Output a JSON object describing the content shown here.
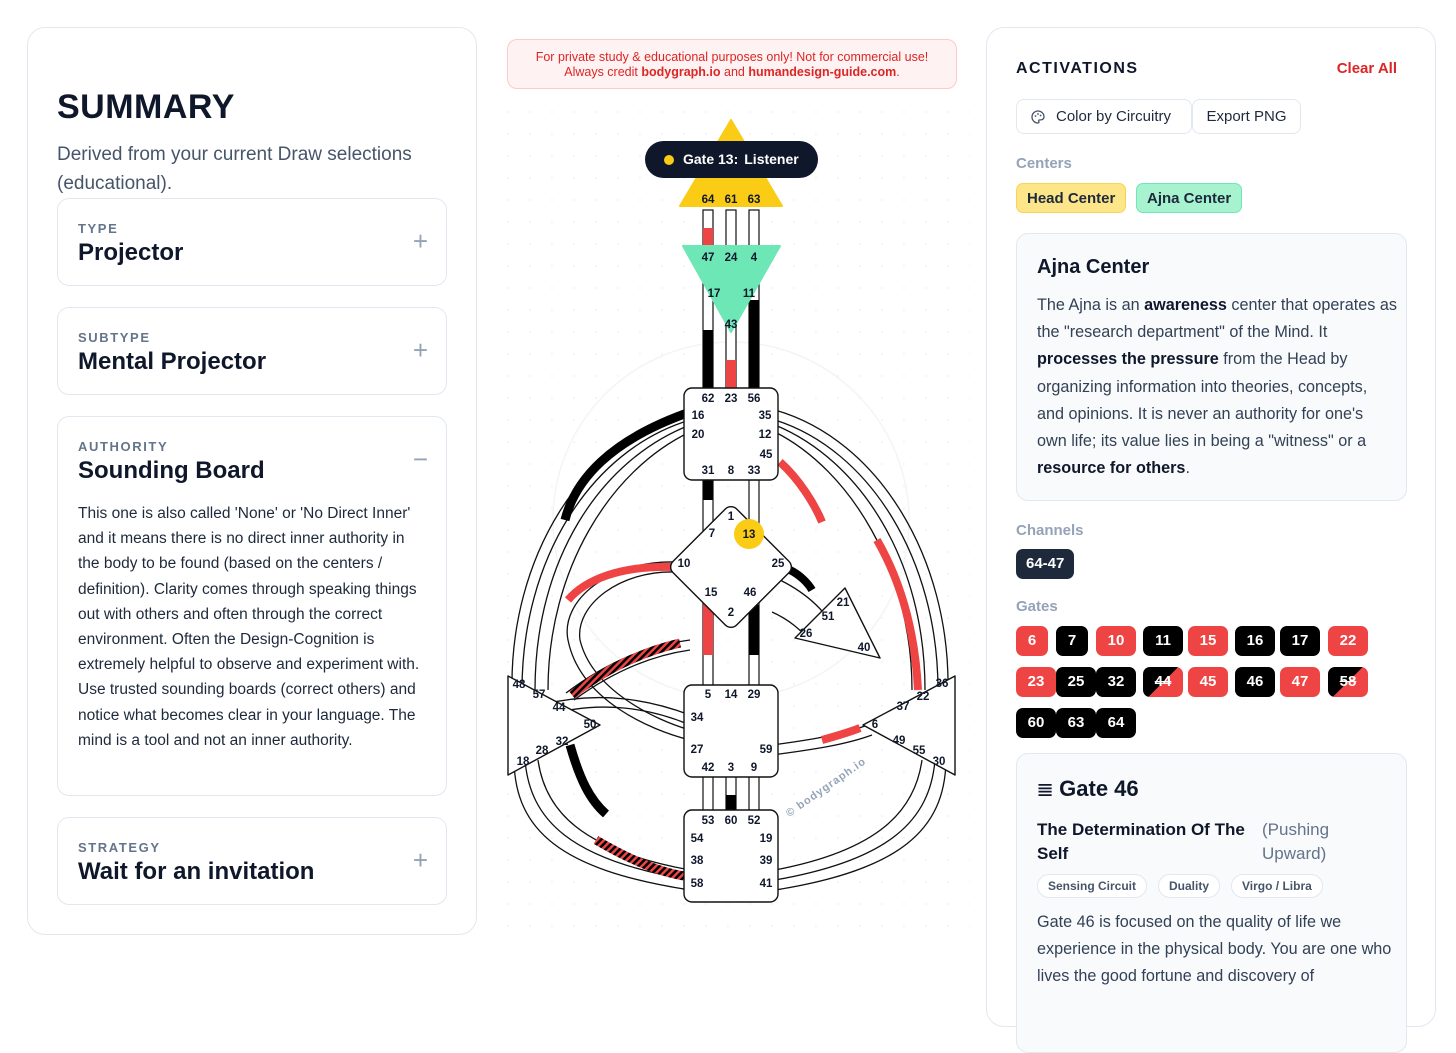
{
  "summary": {
    "title": "SUMMARY",
    "subtitle": "Derived from your current Draw selections (educational).",
    "type": {
      "label": "TYPE",
      "value": "Projector",
      "toggle": "+"
    },
    "subtype": {
      "label": "SUBTYPE",
      "value": "Mental Projector",
      "toggle": "+"
    },
    "authority": {
      "label": "AUTHORITY",
      "value": "Sounding Board",
      "toggle": "−",
      "body": "This one is also called 'None' or 'No Direct Inner' and it means there is no direct inner authority in the body to be found (based on the centers / definition). Clarity comes through speaking things out with others and often through the correct environment. Often the Design-Cognition is extremely helpful to observe and experiment with. Use trusted sounding boards (correct others) and notice what becomes clear in your language. The mind is a tool and not an inner authority."
    },
    "strategy": {
      "label": "STRATEGY",
      "value": "Wait for an invitation",
      "toggle": "+"
    }
  },
  "notice": {
    "line1": "For private study & educational purposes only! Not for commercial use!",
    "line2_prefix": "Always credit ",
    "link1": "bodygraph.io",
    "line2_mid": " and ",
    "link2": "humandesign-guide.com",
    "line2_suffix": "."
  },
  "tooltip": {
    "gate": "Gate 13:",
    "name": "Listener"
  },
  "watermark": "© bodygraph.io",
  "bodygraph": {
    "head_gates": [
      "64",
      "61",
      "63"
    ],
    "ajna_gates": [
      "47",
      "24",
      "4",
      "17",
      "11",
      "43"
    ],
    "throat_gates": [
      "62",
      "23",
      "56",
      "16",
      "35",
      "20",
      "12",
      "45",
      "31",
      "8",
      "33"
    ],
    "g_gates": [
      "1",
      "7",
      "13",
      "10",
      "25",
      "15",
      "46",
      "2"
    ],
    "ego_gates": [
      "21",
      "51",
      "26",
      "40"
    ],
    "spleen_gates": [
      "48",
      "57",
      "44",
      "50",
      "32",
      "28",
      "18"
    ],
    "sacral_gates": [
      "5",
      "14",
      "29",
      "34",
      "27",
      "59",
      "42",
      "3",
      "9"
    ],
    "solar_gates": [
      "36",
      "22",
      "37",
      "6",
      "49",
      "55",
      "30"
    ],
    "root_gates": [
      "53",
      "60",
      "52",
      "54",
      "19",
      "38",
      "39",
      "58",
      "41"
    ]
  },
  "activations": {
    "title": "ACTIVATIONS",
    "clear": "Clear All",
    "color_btn": "Color by Circuitry",
    "export_btn": "Export PNG",
    "centers_label": "Centers",
    "centers": [
      "Head Center",
      "Ajna Center"
    ],
    "info": {
      "title": "Ajna Center",
      "p1": "The Ajna is an ",
      "b1": "awareness",
      "p2": " center that operates as the \"research department\" of the Mind. It ",
      "b2": "processes the pressure",
      "p3": " from the Head by organizing information into theories, concepts, and opinions. It is never an authority for one's own life; its value lies in being a \"witness\" or a ",
      "b3": "resource for others",
      "p4": "."
    },
    "channels_label": "Channels",
    "channels": [
      "64-47"
    ],
    "gates_label": "Gates",
    "gates": [
      {
        "n": "6",
        "c": "r"
      },
      {
        "n": "7",
        "c": "b"
      },
      {
        "n": "10",
        "c": "r"
      },
      {
        "n": "11",
        "c": "b"
      },
      {
        "n": "15",
        "c": "r"
      },
      {
        "n": "16",
        "c": "b"
      },
      {
        "n": "17",
        "c": "b"
      },
      {
        "n": "22",
        "c": "r"
      },
      {
        "n": "23",
        "c": "r"
      },
      {
        "n": "25",
        "c": "b"
      },
      {
        "n": "32",
        "c": "b"
      },
      {
        "n": "44",
        "c": "m"
      },
      {
        "n": "45",
        "c": "r"
      },
      {
        "n": "46",
        "c": "b"
      },
      {
        "n": "47",
        "c": "r"
      },
      {
        "n": "58",
        "c": "m"
      },
      {
        "n": "60",
        "c": "b"
      },
      {
        "n": "63",
        "c": "b"
      },
      {
        "n": "64",
        "c": "b"
      }
    ],
    "gate_detail": {
      "icon": "𝌆",
      "title": "Gate 46",
      "name": "The Determination Of The Self",
      "alt": "(Pushing Upward)",
      "tags": [
        "Sensing Circuit",
        "Duality",
        "Virgo / Libra"
      ],
      "desc": "Gate 46 is focused on the quality of life we experience in the physical body. You are one who lives the good fortune and discovery of"
    }
  }
}
